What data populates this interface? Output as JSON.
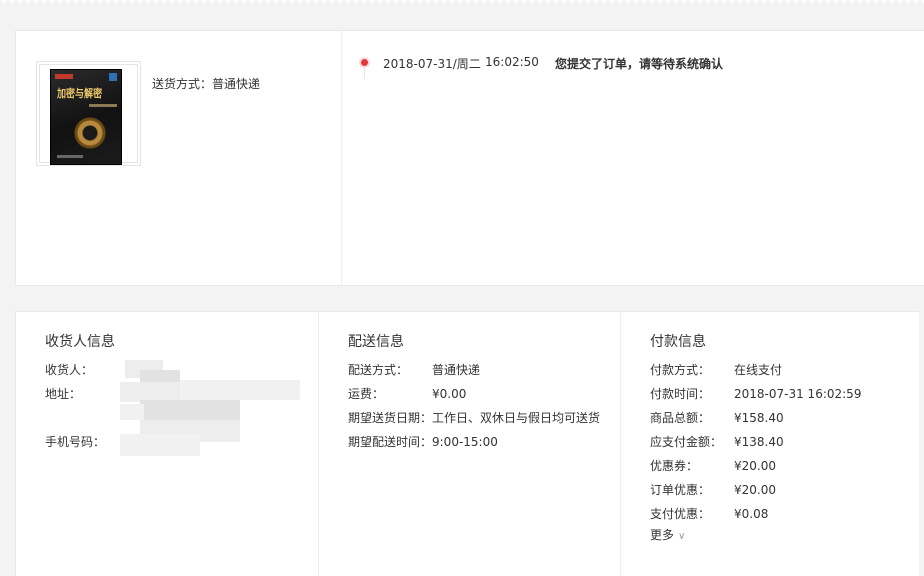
{
  "product": {
    "delivery_method": "送货方式：普通快递",
    "book_title_text": "加密与解密"
  },
  "timeline": {
    "date": "2018-07-31/周二",
    "time": "16:02:50",
    "message": "您提交了订单，请等待系统确认"
  },
  "receiver": {
    "title": "收货人信息",
    "name_label": "收货人：",
    "address_label": "地址：",
    "phone_label": "手机号码："
  },
  "shipping": {
    "title": "配送信息",
    "rows": [
      {
        "label": "配送方式：",
        "value": "普通快递"
      },
      {
        "label": "运费：",
        "value": "¥0.00"
      },
      {
        "label": "期望送货日期：",
        "value": "工作日、双休日与假日均可送货"
      },
      {
        "label": "期望配送时间：",
        "value": "9:00-15:00"
      }
    ]
  },
  "payment": {
    "title": "付款信息",
    "rows": [
      {
        "label": "付款方式：",
        "value": "在线支付"
      },
      {
        "label": "付款时间：",
        "value": "2018-07-31 16:02:59"
      },
      {
        "label": "商品总额：",
        "value": "¥158.40"
      },
      {
        "label": "应支付金额：",
        "value": "¥138.40"
      },
      {
        "label": "优惠券：",
        "value": "¥20.00"
      },
      {
        "label": "订单优惠：",
        "value": "¥20.00"
      },
      {
        "label": "支付优惠：",
        "value": "¥0.08"
      }
    ],
    "more_label": "更多"
  },
  "colors": {
    "accent": "#e4393c",
    "text": "#333333",
    "border": "#eeeeee",
    "background": "#f3f3f3"
  }
}
